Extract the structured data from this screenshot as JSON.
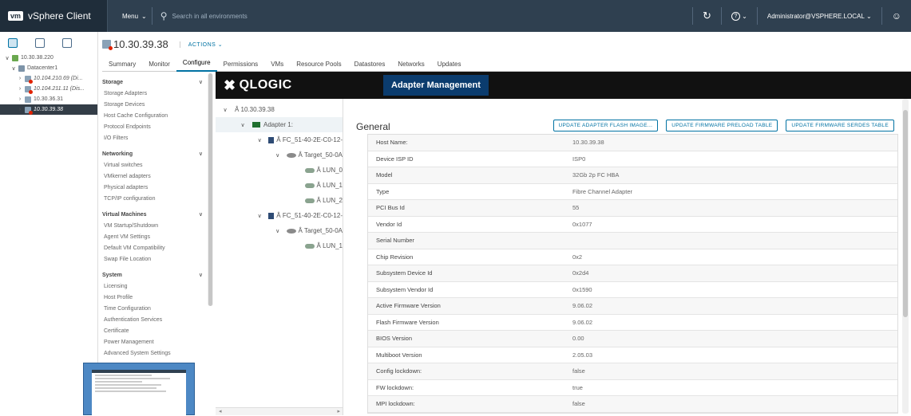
{
  "topbar": {
    "logo": "vm",
    "app_name": "vSphere Client",
    "menu_label": "Menu",
    "search_placeholder": "Search in all environments",
    "user": "Administrator@VSPHERE.LOCAL"
  },
  "nav_tree": [
    {
      "label": "10.30.38.220",
      "italic": false,
      "indent": 0,
      "caret": "v",
      "icon": "vcenter"
    },
    {
      "label": "Datacenter1",
      "italic": false,
      "indent": 1,
      "caret": "v",
      "icon": "datacenter"
    },
    {
      "label": "10.104.210.69 (Di...",
      "italic": true,
      "indent": 2,
      "caret": ">",
      "icon": "host-warn"
    },
    {
      "label": "10.104.211.11 (Dis...",
      "italic": true,
      "indent": 2,
      "caret": ">",
      "icon": "host-warn"
    },
    {
      "label": "10.30.36.31",
      "italic": false,
      "indent": 2,
      "caret": ">",
      "icon": "host"
    },
    {
      "label": "10.30.39.38",
      "italic": true,
      "indent": 2,
      "caret": ">",
      "icon": "host-warn",
      "selected": true
    }
  ],
  "header": {
    "title": "10.30.39.38",
    "actions_label": "ACTIONS",
    "tabs": [
      {
        "label": "Summary",
        "active": false
      },
      {
        "label": "Monitor",
        "active": false
      },
      {
        "label": "Configure",
        "active": true
      },
      {
        "label": "Permissions",
        "active": false
      },
      {
        "label": "VMs",
        "active": false
      },
      {
        "label": "Resource Pools",
        "active": false
      },
      {
        "label": "Datastores",
        "active": false
      },
      {
        "label": "Networks",
        "active": false
      },
      {
        "label": "Updates",
        "active": false
      }
    ]
  },
  "config_nav": [
    {
      "section": "Storage",
      "items": [
        "Storage Adapters",
        "Storage Devices",
        "Host Cache Configuration",
        "Protocol Endpoints",
        "I/O Filters"
      ]
    },
    {
      "section": "Networking",
      "items": [
        "Virtual switches",
        "VMkernel adapters",
        "Physical adapters",
        "TCP/IP configuration"
      ]
    },
    {
      "section": "Virtual Machines",
      "items": [
        "VM Startup/Shutdown",
        "Agent VM Settings",
        "Default VM Compatibility",
        "Swap File Location"
      ]
    },
    {
      "section": "System",
      "items": [
        "Licensing",
        "Host Profile",
        "Time Configuration",
        "Authentication Services",
        "Certificate",
        "Power Management",
        "Advanced System Settings"
      ]
    }
  ],
  "banner": {
    "brand": "QLOGIC",
    "title": "Adapter Management"
  },
  "adapter_tree": [
    {
      "label": "Â 10.30.39.38",
      "indent": 0,
      "caret": "v",
      "icon": "none"
    },
    {
      "label": "Adapter 1:",
      "indent": 1,
      "caret": "v",
      "icon": "adapter",
      "highlight": true
    },
    {
      "label": "Â FC_51-40-2E-C0-12-",
      "indent": 2,
      "caret": "v",
      "icon": "fc"
    },
    {
      "label": "Â Target_50-0A",
      "indent": 3,
      "caret": "v",
      "icon": "target"
    },
    {
      "label": "Â LUN_0",
      "indent": 4,
      "caret": "",
      "icon": "lun"
    },
    {
      "label": "Â LUN_1",
      "indent": 4,
      "caret": "",
      "icon": "lun"
    },
    {
      "label": "Â LUN_2",
      "indent": 4,
      "caret": "",
      "icon": "lun"
    },
    {
      "label": "Â FC_51-40-2E-C0-12-",
      "indent": 2,
      "caret": "v",
      "icon": "fc"
    },
    {
      "label": "Â Target_50-0A",
      "indent": 3,
      "caret": "v",
      "icon": "target"
    },
    {
      "label": "Â LUN_1",
      "indent": 4,
      "caret": "",
      "icon": "lun"
    }
  ],
  "general": {
    "title": "General",
    "buttons": [
      "UPDATE ADAPTER FLASH IMAGE...",
      "UPDATE FIRMWARE PRELOAD TABLE",
      "UPDATE FIRMWARE SERDES TABLE"
    ],
    "properties": [
      {
        "key": "Host Name:",
        "value": "10.30.39.38"
      },
      {
        "key": "Device ISP ID",
        "value": "ISP0"
      },
      {
        "key": "Model",
        "value": "32Gb 2p FC HBA"
      },
      {
        "key": "Type",
        "value": "Fibre Channel Adapter"
      },
      {
        "key": "PCI Bus Id",
        "value": "55"
      },
      {
        "key": "Vendor Id",
        "value": "0x1077"
      },
      {
        "key": "Serial Number",
        "value": ""
      },
      {
        "key": "Chip Revision",
        "value": "0x2"
      },
      {
        "key": "Subsystem Device Id",
        "value": "0x2d4"
      },
      {
        "key": "Subsystem Vendor Id",
        "value": "0x1590"
      },
      {
        "key": "Active Firmware Version",
        "value": "9.06.02"
      },
      {
        "key": "Flash Firmware Version",
        "value": "9.06.02"
      },
      {
        "key": "BIOS Version",
        "value": "0.00"
      },
      {
        "key": "Multiboot Version",
        "value": "2.05.03"
      },
      {
        "key": "Config lockdown:",
        "value": "false"
      },
      {
        "key": "FW lockdown:",
        "value": "true"
      },
      {
        "key": "MPI lockdown:",
        "value": "false"
      }
    ]
  }
}
